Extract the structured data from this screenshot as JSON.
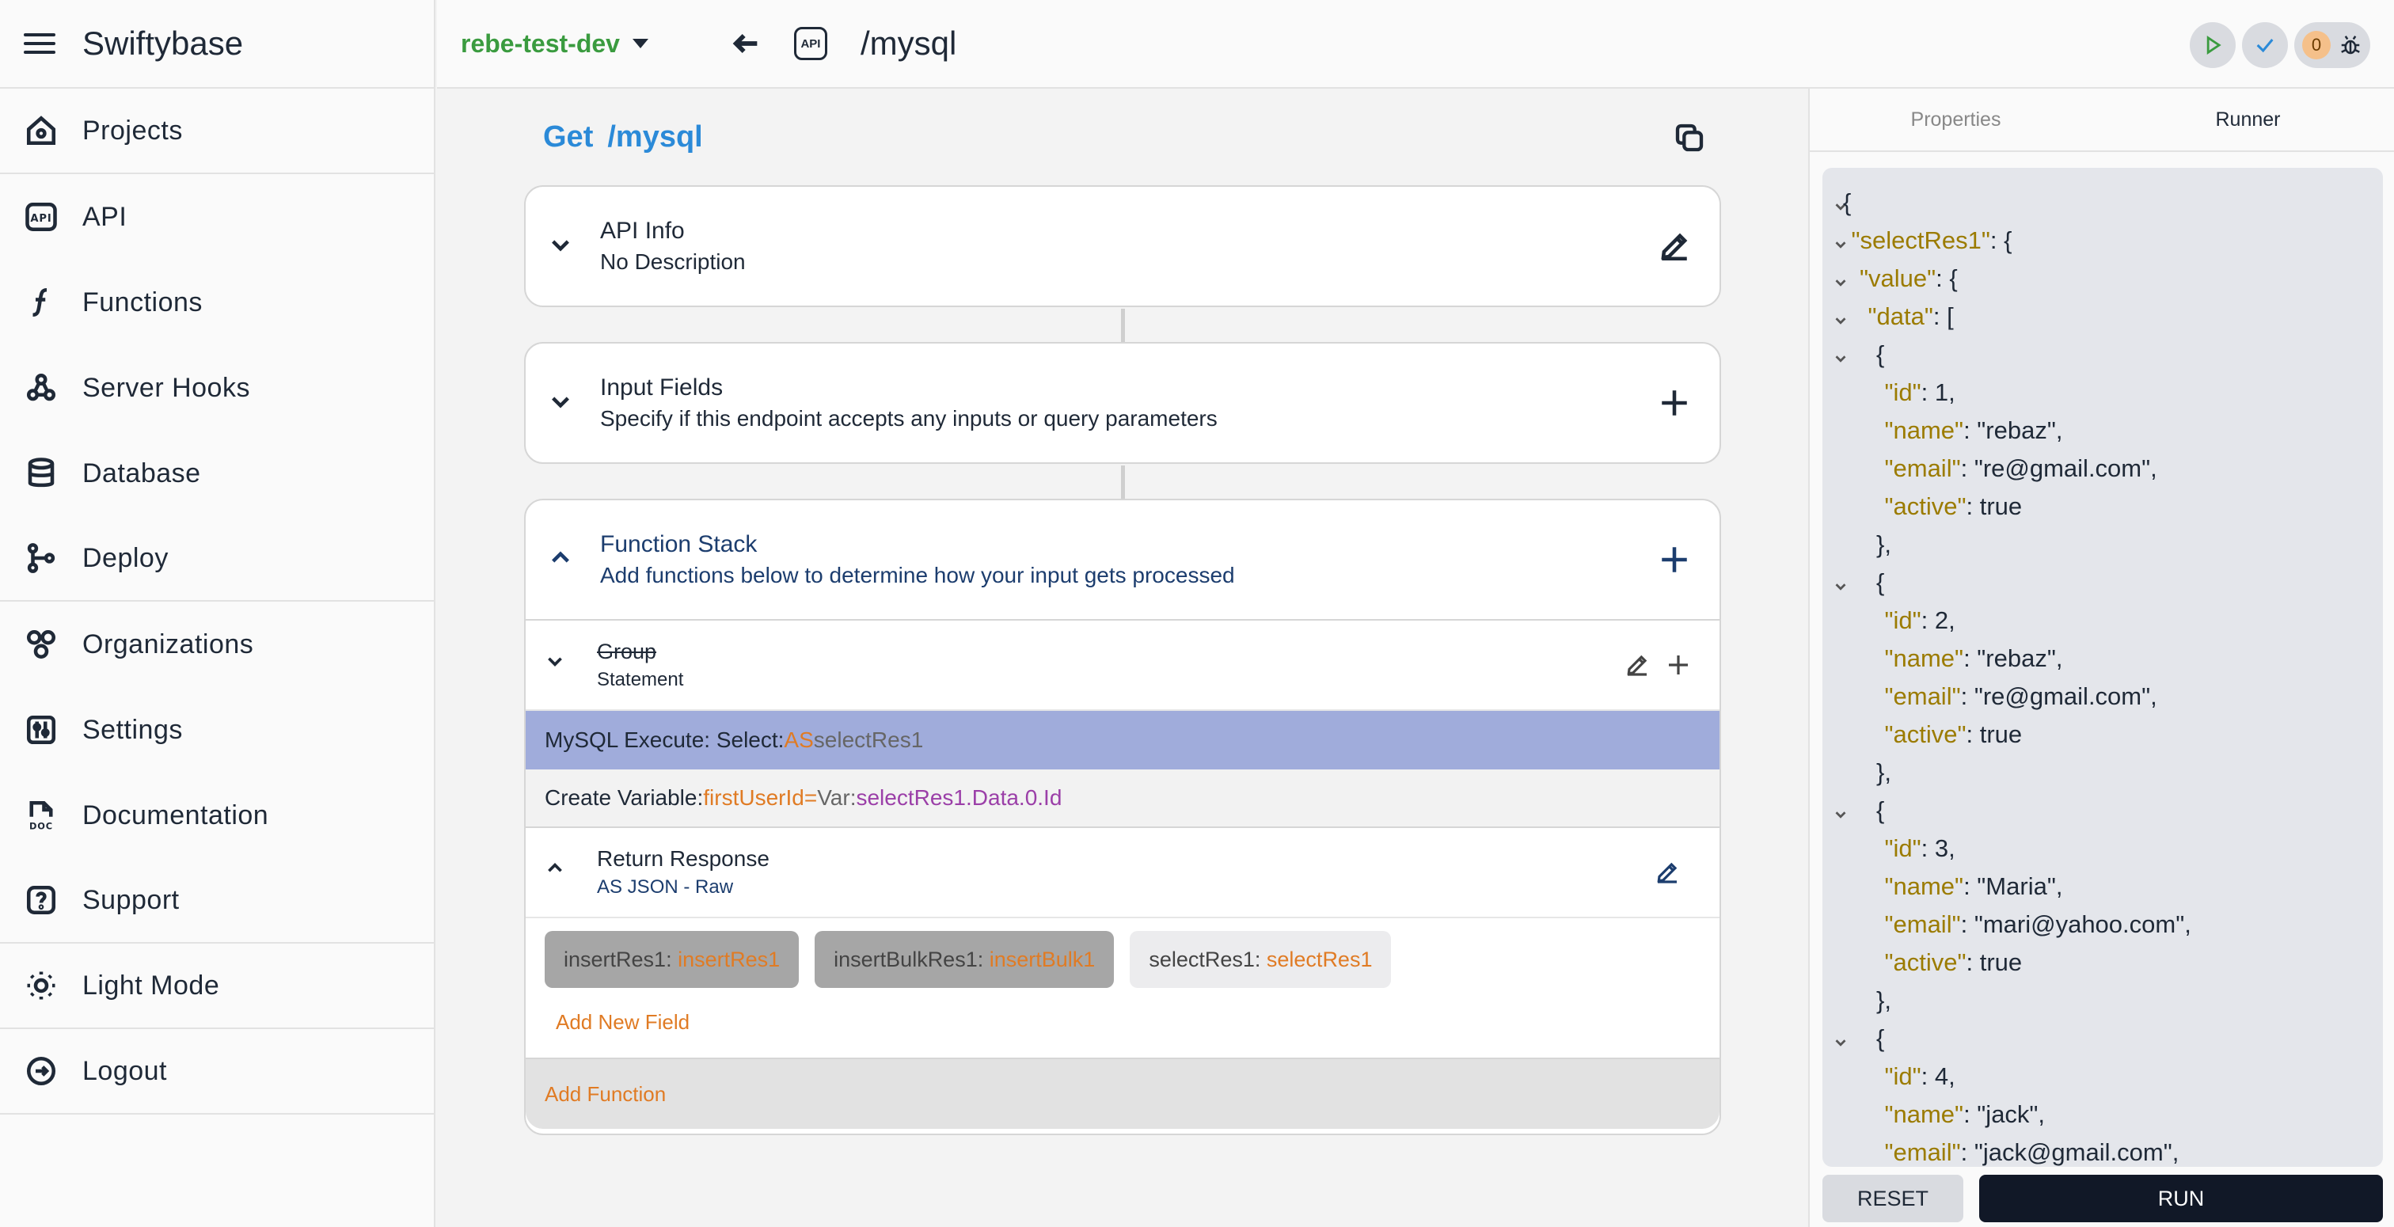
{
  "app": {
    "title": "Swiftybase"
  },
  "sidebar": {
    "items": [
      {
        "label": "Projects",
        "icon": "home-icon"
      },
      {
        "label": "API",
        "icon": "api-icon"
      },
      {
        "label": "Functions",
        "icon": "function-icon"
      },
      {
        "label": "Server Hooks",
        "icon": "webhook-icon"
      },
      {
        "label": "Database",
        "icon": "database-icon"
      },
      {
        "label": "Deploy",
        "icon": "git-branch-icon"
      },
      {
        "label": "Organizations",
        "icon": "organizations-icon"
      },
      {
        "label": "Settings",
        "icon": "settings-icon"
      },
      {
        "label": "Documentation",
        "icon": "doc-icon"
      },
      {
        "label": "Support",
        "icon": "help-icon"
      },
      {
        "label": "Light Mode",
        "icon": "sun-icon"
      },
      {
        "label": "Logout",
        "icon": "logout-icon"
      }
    ]
  },
  "topbar": {
    "environment": "rebe-test-dev",
    "api_badge": "API",
    "path": "/mysql",
    "error_count": "0"
  },
  "main": {
    "method": "Get",
    "path": "/mysql",
    "api_info": {
      "title": "API Info",
      "desc": "No Description"
    },
    "input_fields": {
      "title": "Input Fields",
      "desc": "Specify if this endpoint accepts any inputs or query parameters"
    },
    "function_stack": {
      "title": "Function Stack",
      "desc": "Add functions below to determine how your input gets processed",
      "group": {
        "title": "Group",
        "sub": "Statement"
      },
      "mysql": {
        "prefix": "MySQL Execute: Select: ",
        "as": "AS",
        "name": " selectRes1"
      },
      "variable": {
        "prefix": "Create Variable: ",
        "name": "firstUserId",
        "eq": " = ",
        "var_label": "Var: ",
        "value": "selectRes1.Data.0.Id"
      },
      "return": {
        "title": "Return Response",
        "sub": "AS JSON - Raw"
      },
      "fields": [
        {
          "key": "insertRes1",
          "value": "insertRes1"
        },
        {
          "key": "insertBulkRes1",
          "value": "insertBulk1"
        },
        {
          "key": "selectRes1",
          "value": "selectRes1"
        }
      ],
      "add_field": "Add New Field",
      "add_function": "Add Function"
    }
  },
  "runner": {
    "tabs": [
      "Properties",
      "Runner"
    ],
    "json_lines": [
      {
        "t": "{"
      },
      {
        "t": "  \"selectRes1\": {"
      },
      {
        "t": "    \"value\": {"
      },
      {
        "t": "      \"data\": ["
      },
      {
        "t": "        {"
      },
      {
        "t": "          \"id\": 1,"
      },
      {
        "t": "          \"name\": \"rebaz\","
      },
      {
        "t": "          \"email\": \"re@gmail.com\","
      },
      {
        "t": "          \"active\": true"
      },
      {
        "t": "        },"
      },
      {
        "t": "        {"
      },
      {
        "t": "          \"id\": 2,"
      },
      {
        "t": "          \"name\": \"rebaz\","
      },
      {
        "t": "          \"email\": \"re@gmail.com\","
      },
      {
        "t": "          \"active\": true"
      },
      {
        "t": "        },"
      },
      {
        "t": "        {"
      },
      {
        "t": "          \"id\": 3,"
      },
      {
        "t": "          \"name\": \"Maria\","
      },
      {
        "t": "          \"email\": \"mari@yahoo.com\","
      },
      {
        "t": "          \"active\": true"
      },
      {
        "t": "        },"
      },
      {
        "t": "        {"
      },
      {
        "t": "          \"id\": 4,"
      },
      {
        "t": "          \"name\": \"jack\","
      },
      {
        "t": "          \"email\": \"jack@gmail.com\","
      }
    ],
    "reset": "RESET",
    "run": "RUN"
  }
}
